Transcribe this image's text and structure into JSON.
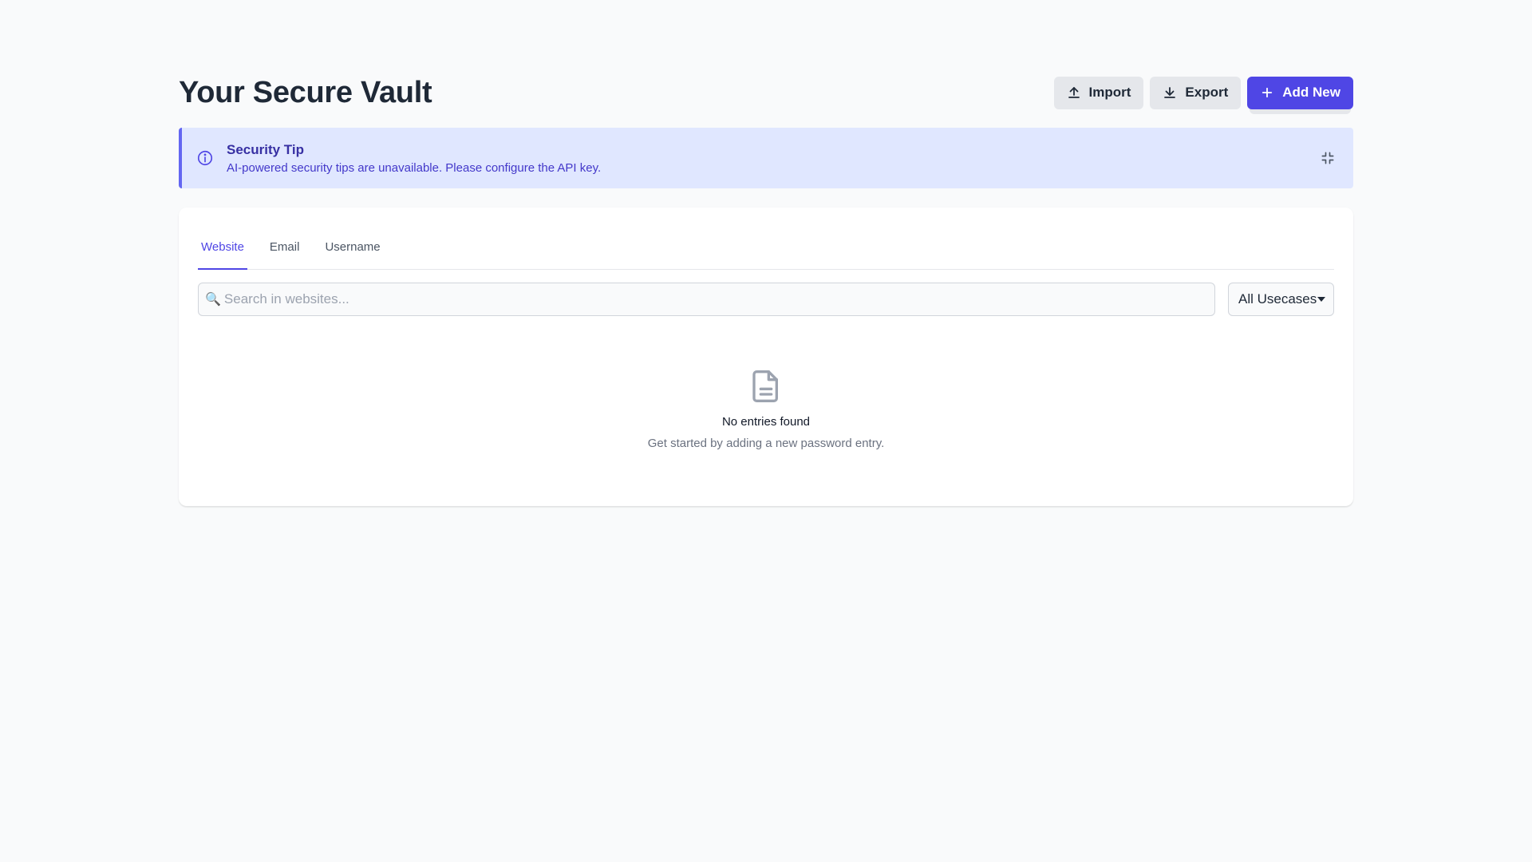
{
  "header": {
    "title": "Your Secure Vault",
    "import_label": "Import",
    "export_label": "Export",
    "add_label": "Add New"
  },
  "tip": {
    "title": "Security Tip",
    "message": "AI-powered security tips are unavailable. Please configure the API key."
  },
  "tabs": [
    {
      "label": "Website",
      "active": true
    },
    {
      "label": "Email",
      "active": false
    },
    {
      "label": "Username",
      "active": false
    }
  ],
  "search": {
    "placeholder": "Search in websites...",
    "value": ""
  },
  "filter": {
    "selected": "All Usecases"
  },
  "empty_state": {
    "title": "No entries found",
    "subtitle": "Get started by adding a new password entry."
  },
  "colors": {
    "primary": "#4f46e5",
    "tip_background": "#e0e7ff",
    "tip_border": "#6366f1"
  }
}
